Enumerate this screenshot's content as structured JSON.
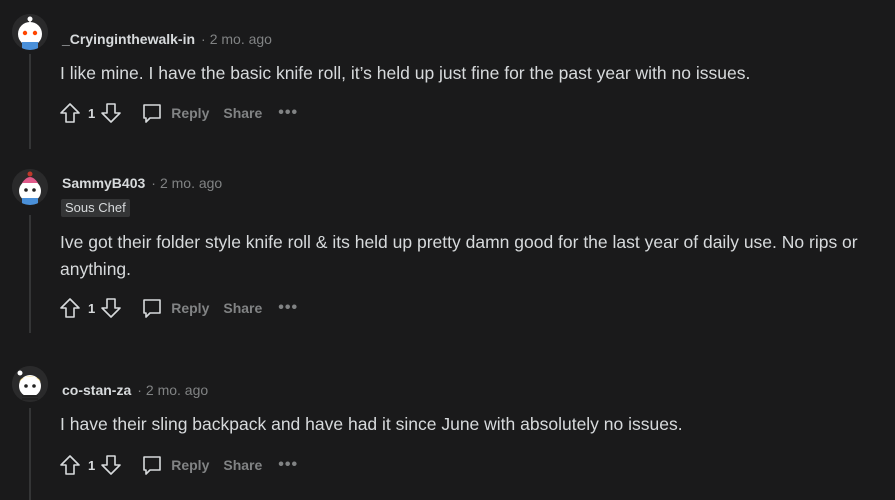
{
  "comments": [
    {
      "username": "_Cryinginthewalk-in",
      "separator": "·",
      "time": "2 mo. ago",
      "flair": "",
      "body": "I like mine. I have the basic knife roll, it’s held up just fine for the past year with no issues.",
      "score": "1",
      "reply_label": "Reply",
      "share_label": "Share",
      "more_label": "•••",
      "avatar_icon": "robot-avatar-icon"
    },
    {
      "username": "SammyB403",
      "separator": "·",
      "time": "2 mo. ago",
      "flair": "Sous Chef",
      "body": "Ive got their folder style knife roll & its held up pretty damn good for the last year of daily use. No rips or anything.",
      "score": "1",
      "reply_label": "Reply",
      "share_label": "Share",
      "more_label": "•••",
      "avatar_icon": "cupcake-avatar-icon"
    },
    {
      "username": "co-stan-za",
      "separator": "·",
      "time": "2 mo. ago",
      "flair": "",
      "body": "I have their sling backpack and have had it since June with absolutely no issues.",
      "score": "1",
      "reply_label": "Reply",
      "share_label": "Share",
      "more_label": "•••",
      "avatar_icon": "blonde-avatar-icon"
    }
  ],
  "colors": {
    "background": "#1a1a1b",
    "text": "#d7dadc",
    "muted": "#818384",
    "flair_bg": "#343536"
  }
}
